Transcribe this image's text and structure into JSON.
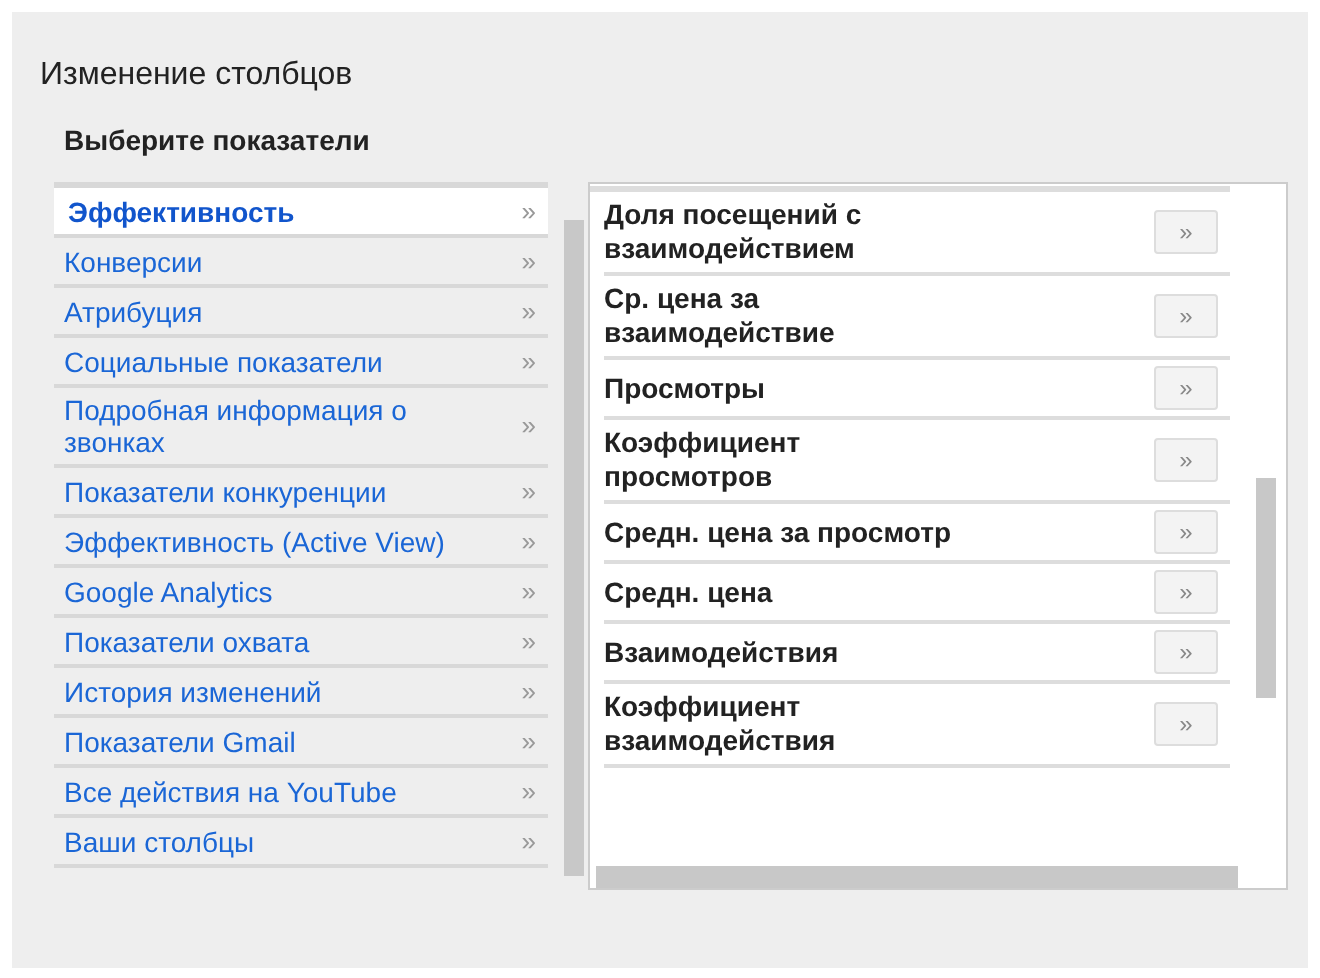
{
  "title": "Изменение столбцов",
  "subtitle": "Выберите показатели",
  "categories": [
    {
      "label": "Эффективность",
      "arrow": "»",
      "selected": true
    },
    {
      "label": "Конверсии",
      "arrow": "»",
      "selected": false
    },
    {
      "label": "Атрибуция",
      "arrow": "»",
      "selected": false
    },
    {
      "label": "Социальные показатели",
      "arrow": "»",
      "selected": false
    },
    {
      "label": "Подробная информация о звонках",
      "arrow": "»",
      "selected": false
    },
    {
      "label": "Показатели конкуренции",
      "arrow": "»",
      "selected": false
    },
    {
      "label": "Эффективность (Active View)",
      "arrow": "»",
      "selected": false
    },
    {
      "label": "Google Analytics",
      "arrow": "»",
      "selected": false
    },
    {
      "label": "Показатели охвата",
      "arrow": "»",
      "selected": false
    },
    {
      "label": "История изменений",
      "arrow": "»",
      "selected": false
    },
    {
      "label": "Показатели Gmail",
      "arrow": "»",
      "selected": false
    },
    {
      "label": "Все действия на YouTube",
      "arrow": "»",
      "selected": false
    },
    {
      "label": "Ваши столбцы",
      "arrow": "»",
      "selected": false
    }
  ],
  "metrics": [
    {
      "label": "Доля посещений с взаимодействием",
      "button": "»"
    },
    {
      "label": "Ср. цена за взаимодействие",
      "button": "»"
    },
    {
      "label": "Просмотры",
      "button": "»"
    },
    {
      "label": "Коэффициент просмотров",
      "button": "»"
    },
    {
      "label": "Средн. цена за просмотр",
      "button": "»"
    },
    {
      "label": "Средн. цена",
      "button": "»"
    },
    {
      "label": "Взаимодействия",
      "button": "»"
    },
    {
      "label": "Коэффициент взаимодействия",
      "button": "»"
    }
  ]
}
